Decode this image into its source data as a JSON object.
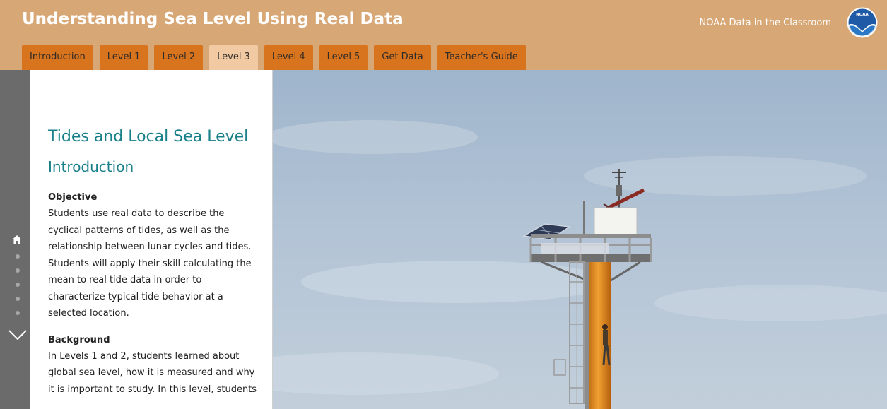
{
  "header": {
    "site_title": "Understanding Sea Level Using Real Data",
    "org_link": "NOAA Data in the Classroom",
    "logo_text": "NOAA",
    "background_color": "#d8a776"
  },
  "tabs": [
    {
      "label": "Introduction",
      "active": false
    },
    {
      "label": "Level 1",
      "active": false
    },
    {
      "label": "Level 2",
      "active": false
    },
    {
      "label": "Level 3",
      "active": true
    },
    {
      "label": "Level 4",
      "active": false
    },
    {
      "label": "Level 5",
      "active": false
    },
    {
      "label": "Get Data",
      "active": false
    },
    {
      "label": "Teacher's Guide",
      "active": false
    }
  ],
  "sidebar": {
    "icons": [
      "home-icon",
      "chevron-down-icon"
    ],
    "dot_count": 5
  },
  "content": {
    "title": "Tides and Local Sea Level",
    "subtitle": "Introduction",
    "objective_heading": "Objective",
    "objective_text": "Students use real data to describe the cyclical patterns of tides, as well as the relationship between lunar cycles and tides. Students will apply their skill calculating the mean to real tide data in order to characterize typical tide behavior at a selected location.",
    "background_heading": "Background",
    "background_text": "In Levels 1 and 2, students learned about global sea level, how it is measured and why it is important to study. In this level, students"
  },
  "colors": {
    "tab": "#d8731e",
    "tab_active": "#f1c9a3",
    "heading": "#19808a",
    "rail": "#6b6b6b"
  }
}
